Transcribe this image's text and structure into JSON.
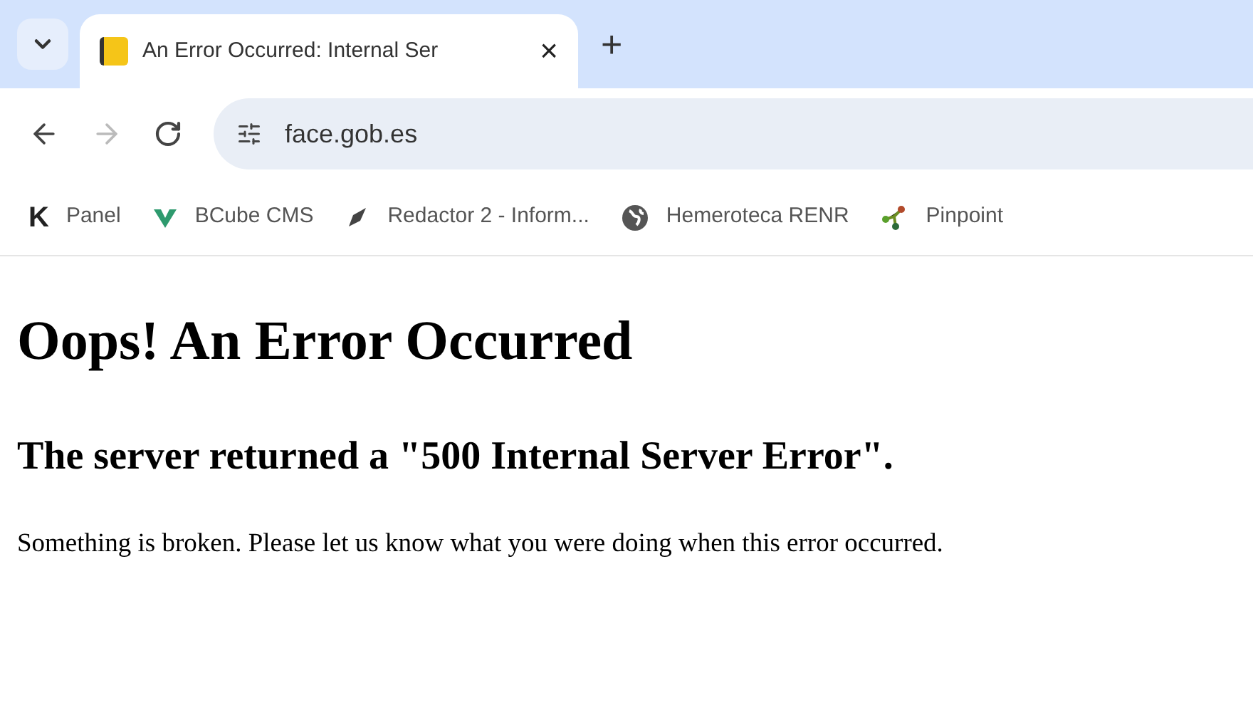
{
  "tabs": [
    {
      "title": "An Error Occurred: Internal Ser",
      "selected": true,
      "close": "×"
    }
  ],
  "new_tab": "+",
  "address_bar": {
    "url": "face.gob.es"
  },
  "bookmarks": [
    {
      "label": "Panel",
      "kind": "letter",
      "icon": "K"
    },
    {
      "label": "BCube CMS",
      "kind": "chevron"
    },
    {
      "label": "Redactor 2 - Inform...",
      "kind": "pen"
    },
    {
      "label": "Hemeroteca RENR",
      "kind": "globe"
    },
    {
      "label": "Pinpoint",
      "kind": "nodes"
    }
  ],
  "page": {
    "heading": "Oops! An Error Occurred",
    "subheading": "The server returned a \"500 Internal Server Error\".",
    "message": "Something is broken. Please let us know what you were doing when this error occurred."
  }
}
